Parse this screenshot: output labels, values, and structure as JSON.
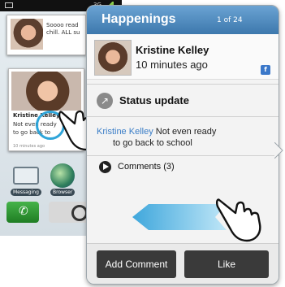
{
  "phone": {
    "status_net": "3G",
    "widget1_text_line1": "Soooo read",
    "widget1_text_line2": "chill. ALL su",
    "widget2_name": "Kristine Kelley",
    "widget2_line1": "Not even ready",
    "widget2_line2": "to go back to",
    "widget2_time": "10 minutes ago",
    "dock_messaging": "Messaging",
    "dock_browser": "Browser"
  },
  "card": {
    "title": "Happenings",
    "count": "1 of 24",
    "author_name": "Kristine Kelley",
    "author_time": "10 minutes ago",
    "service_badge": "f",
    "status_label": "Status update",
    "message_author": "Kristine Kelley",
    "message_text_1": "Not even ready",
    "message_text_2": "to go back to school",
    "comments_label": "Comments (3)",
    "add_comment_label": "Add Comment",
    "like_label": "Like"
  },
  "colors": {
    "header_top": "#6aa3d3",
    "header_bottom": "#3d78ad",
    "link": "#3a7dc7",
    "button": "#3a3a3a",
    "tap_ring": "#2fa5d9",
    "swipe_arrow": "#6cc0ea"
  }
}
